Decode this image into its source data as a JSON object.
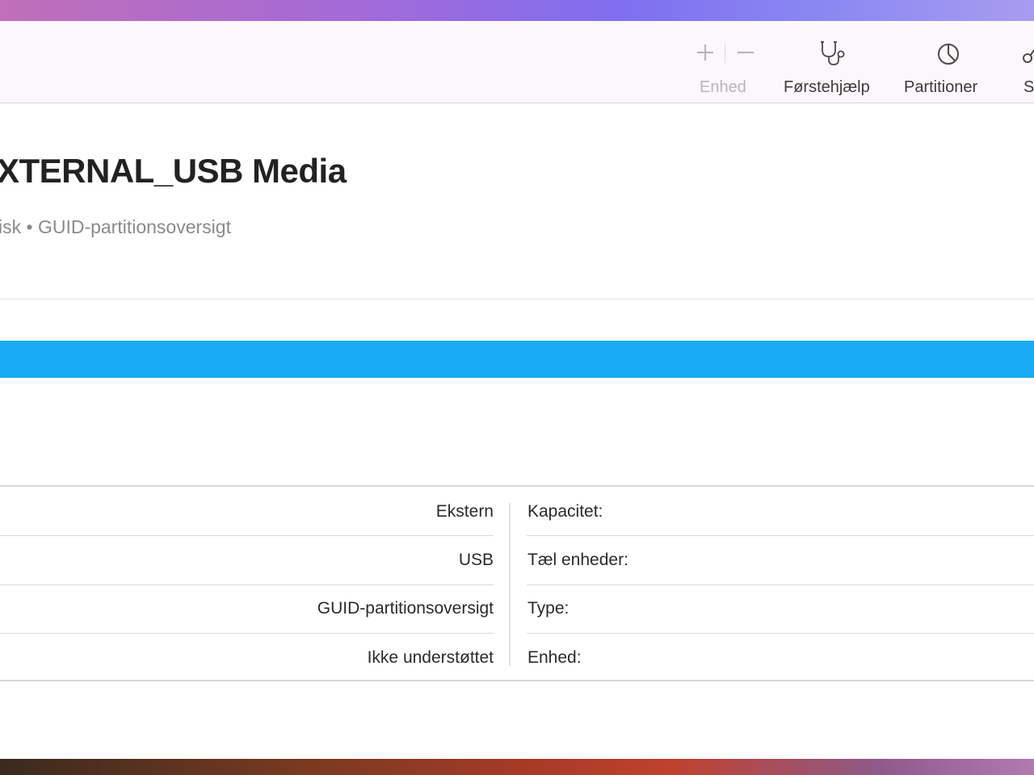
{
  "toolbar": {
    "add_symbol": "+",
    "remove_symbol": "−",
    "device_label": "Enhed",
    "first_aid_label": "Førstehjælp",
    "partition_label": "Partitioner",
    "cut_label": "S"
  },
  "disk": {
    "title": "XTERNAL_USB Media",
    "subtitle": "isk • GUID-partitionsoversigt"
  },
  "info": {
    "left_values": [
      "Ekstern",
      "USB",
      "GUID-partitionsoversigt",
      "Ikke understøttet"
    ],
    "right_keys": [
      "Kapacitet:",
      "Tæl enheder:",
      "Type:",
      "Enhed:"
    ]
  },
  "colors": {
    "usage_bar": "#18aaf2",
    "toolbar_bg": "#fbf7fb"
  },
  "icons": [
    "plus-icon",
    "minus-icon",
    "stethoscope-icon",
    "pie-chart-icon",
    "partial-icon"
  ]
}
